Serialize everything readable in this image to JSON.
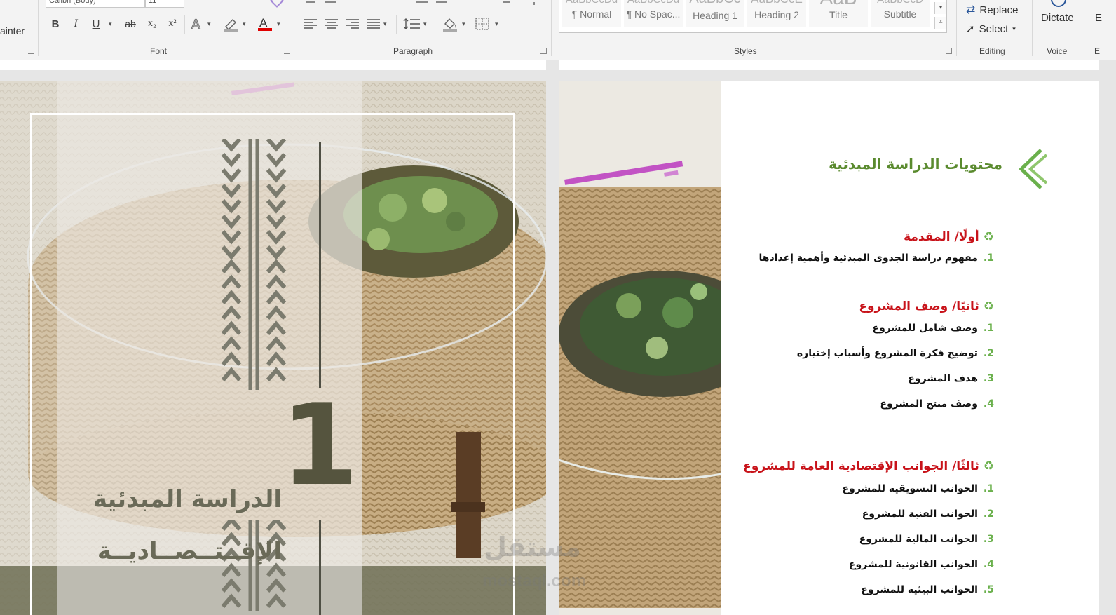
{
  "ribbon": {
    "font_name": "Calibri (Body)",
    "font_size": "11",
    "clipboard_partial": "ainter",
    "groups": {
      "font": "Font",
      "paragraph": "Paragraph",
      "styles": "Styles",
      "editing": "Editing",
      "voice": "Voice",
      "editor_partial": "E"
    },
    "format_buttons": {
      "bold": "B",
      "italic": "I",
      "underline": "U",
      "strikethrough": "ab",
      "subscript": "x₂",
      "superscript": "x²"
    },
    "styles": [
      {
        "sample": "AaBbCcDd",
        "name": "¶ Normal"
      },
      {
        "sample": "AaBbCcDd",
        "name": "¶ No Spac..."
      },
      {
        "sample": "AaBbCc",
        "name": "Heading 1"
      },
      {
        "sample": "AaBbCcE",
        "name": "Heading 2"
      },
      {
        "sample": "AaB",
        "name": "Title"
      },
      {
        "sample": "AaBbCcD",
        "name": "Subtitle"
      }
    ],
    "editing": {
      "replace": "Replace",
      "select": "Select"
    },
    "voice": {
      "dictate": "Dictate"
    },
    "colors": {
      "font_color_bar": "#e00000",
      "accent": "#2b579a"
    }
  },
  "left_page": {
    "title_number": "1",
    "title_line1": "الدراسة المبدئية",
    "title_line2": "الإقــتــصــاديــة"
  },
  "right_page": {
    "heading": "محتويات الدراسة المبدئية",
    "sections": [
      {
        "title": "أولًا/ المقدمة",
        "items": [
          {
            "num": "1.",
            "text": "مفهوم دراسة الجدوى المبدئية وأهمية إعدادها"
          }
        ]
      },
      {
        "title": "ثانيًا/ وصف المشروع",
        "items": [
          {
            "num": "1.",
            "text": "وصف شامل للمشروع"
          },
          {
            "num": "2.",
            "text": "توضيح فكرة المشروع وأسباب إختياره"
          },
          {
            "num": "3.",
            "text": "هدف المشروع"
          },
          {
            "num": "4.",
            "text": "وصف منتج المشروع"
          }
        ]
      },
      {
        "title": "ثالثًا/ الجوانب الإقتصادية العامة للمشروع",
        "items": [
          {
            "num": "1.",
            "text": "الجوانب التسويقية للمشروع"
          },
          {
            "num": "2.",
            "text": "الجوانب الفنية للمشروع"
          },
          {
            "num": "3.",
            "text": "الجوانب المالية للمشروع"
          },
          {
            "num": "4.",
            "text": "الجوانب القانونية للمشروع"
          },
          {
            "num": "5.",
            "text": "الجوانب البيئية للمشروع"
          }
        ]
      }
    ],
    "recycle_glyph": "♻",
    "colors": {
      "heading_green": "#5a8a2e",
      "section_red": "#c8131a",
      "number_green": "#6ab04c"
    }
  },
  "watermark": {
    "arabic": "مستقل",
    "latin": "mostaql.com"
  }
}
